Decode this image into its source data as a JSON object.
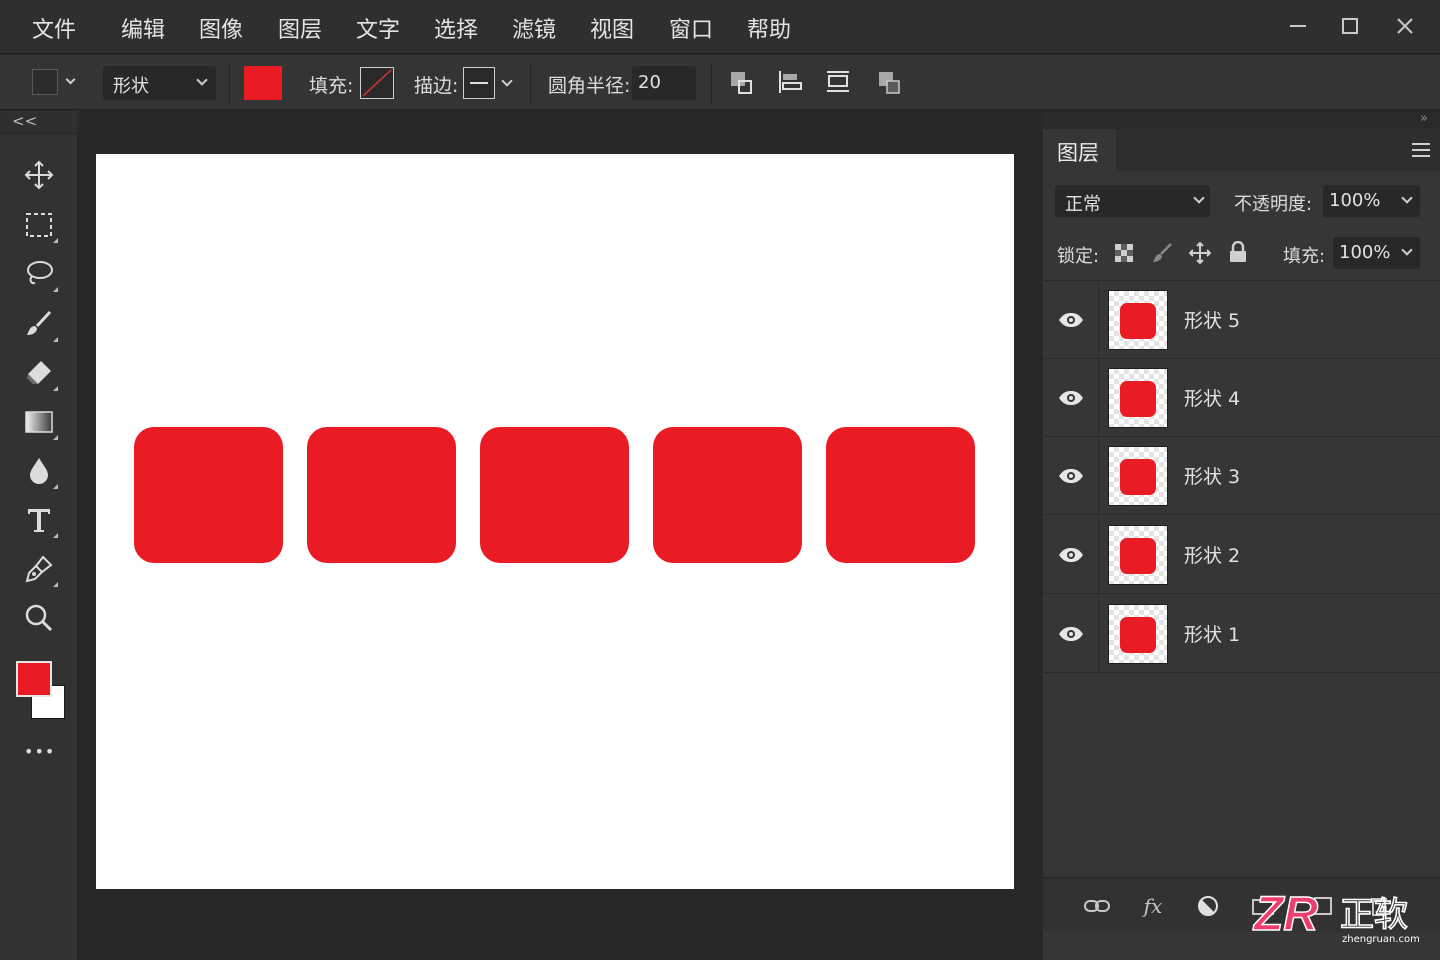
{
  "menubar": {
    "items": [
      "文件",
      "编辑",
      "图像",
      "图层",
      "文字",
      "选择",
      "滤镜",
      "视图",
      "窗口",
      "帮助"
    ],
    "window_controls": [
      "minimize-icon",
      "maximize-icon",
      "close-icon"
    ]
  },
  "options": {
    "tool_mode": "形状",
    "fill_color": "#e91b24",
    "fill_label": "填充:",
    "stroke_label": "描边:",
    "radius_label": "圆角半径:",
    "radius_value": "20"
  },
  "toolbar": {
    "collapse": "<<",
    "tools": [
      "move-tool",
      "marquee-tool",
      "lasso-tool",
      "brush-tool",
      "eraser-tool",
      "gradient-tool",
      "blur-tool",
      "type-tool",
      "pen-tool",
      "zoom-tool"
    ],
    "foreground_color": "#e91b24",
    "background_color": "#ffffff",
    "more": "•••"
  },
  "canvas": {
    "background": "#ffffff",
    "shape_color": "#e91b24",
    "shape_count": 5
  },
  "layers_panel": {
    "tab": "图层",
    "blend_mode": "正常",
    "opacity_label": "不透明度:",
    "opacity_value": "100%",
    "lock_label": "锁定:",
    "fill_label": "填充:",
    "fill_value": "100%",
    "layers": [
      {
        "name": "形状 5",
        "visible": true
      },
      {
        "name": "形状 4",
        "visible": true
      },
      {
        "name": "形状 3",
        "visible": true
      },
      {
        "name": "形状 2",
        "visible": true
      },
      {
        "name": "形状 1",
        "visible": true
      }
    ],
    "footer_icons": [
      "link-icon",
      "fx-icon",
      "adjustment-icon",
      "folder-icon",
      "new-layer-icon",
      "trash-icon"
    ],
    "fx_label": "fx"
  },
  "watermark": {
    "logo_text": "ZR",
    "brand": "正软",
    "url": "zhengruan.com"
  }
}
